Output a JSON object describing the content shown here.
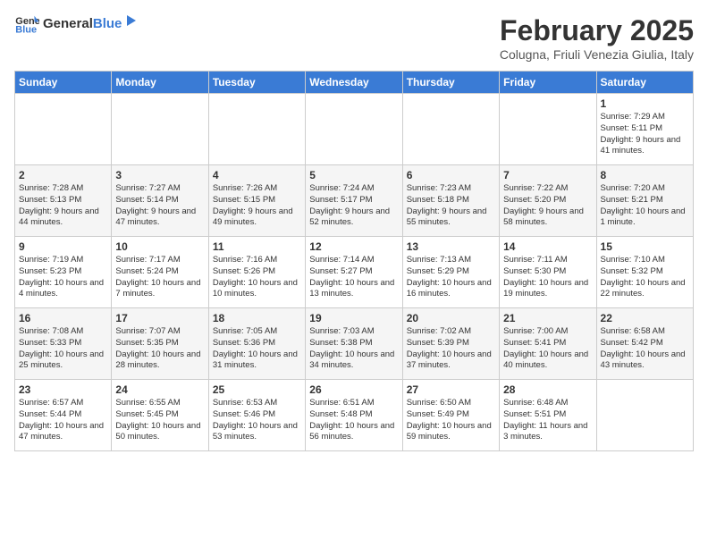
{
  "header": {
    "logo_general": "General",
    "logo_blue": "Blue",
    "month_year": "February 2025",
    "location": "Colugna, Friuli Venezia Giulia, Italy"
  },
  "weekdays": [
    "Sunday",
    "Monday",
    "Tuesday",
    "Wednesday",
    "Thursday",
    "Friday",
    "Saturday"
  ],
  "weeks": [
    [
      {
        "day": "",
        "info": ""
      },
      {
        "day": "",
        "info": ""
      },
      {
        "day": "",
        "info": ""
      },
      {
        "day": "",
        "info": ""
      },
      {
        "day": "",
        "info": ""
      },
      {
        "day": "",
        "info": ""
      },
      {
        "day": "1",
        "info": "Sunrise: 7:29 AM\nSunset: 5:11 PM\nDaylight: 9 hours and 41 minutes."
      }
    ],
    [
      {
        "day": "2",
        "info": "Sunrise: 7:28 AM\nSunset: 5:13 PM\nDaylight: 9 hours and 44 minutes."
      },
      {
        "day": "3",
        "info": "Sunrise: 7:27 AM\nSunset: 5:14 PM\nDaylight: 9 hours and 47 minutes."
      },
      {
        "day": "4",
        "info": "Sunrise: 7:26 AM\nSunset: 5:15 PM\nDaylight: 9 hours and 49 minutes."
      },
      {
        "day": "5",
        "info": "Sunrise: 7:24 AM\nSunset: 5:17 PM\nDaylight: 9 hours and 52 minutes."
      },
      {
        "day": "6",
        "info": "Sunrise: 7:23 AM\nSunset: 5:18 PM\nDaylight: 9 hours and 55 minutes."
      },
      {
        "day": "7",
        "info": "Sunrise: 7:22 AM\nSunset: 5:20 PM\nDaylight: 9 hours and 58 minutes."
      },
      {
        "day": "8",
        "info": "Sunrise: 7:20 AM\nSunset: 5:21 PM\nDaylight: 10 hours and 1 minute."
      }
    ],
    [
      {
        "day": "9",
        "info": "Sunrise: 7:19 AM\nSunset: 5:23 PM\nDaylight: 10 hours and 4 minutes."
      },
      {
        "day": "10",
        "info": "Sunrise: 7:17 AM\nSunset: 5:24 PM\nDaylight: 10 hours and 7 minutes."
      },
      {
        "day": "11",
        "info": "Sunrise: 7:16 AM\nSunset: 5:26 PM\nDaylight: 10 hours and 10 minutes."
      },
      {
        "day": "12",
        "info": "Sunrise: 7:14 AM\nSunset: 5:27 PM\nDaylight: 10 hours and 13 minutes."
      },
      {
        "day": "13",
        "info": "Sunrise: 7:13 AM\nSunset: 5:29 PM\nDaylight: 10 hours and 16 minutes."
      },
      {
        "day": "14",
        "info": "Sunrise: 7:11 AM\nSunset: 5:30 PM\nDaylight: 10 hours and 19 minutes."
      },
      {
        "day": "15",
        "info": "Sunrise: 7:10 AM\nSunset: 5:32 PM\nDaylight: 10 hours and 22 minutes."
      }
    ],
    [
      {
        "day": "16",
        "info": "Sunrise: 7:08 AM\nSunset: 5:33 PM\nDaylight: 10 hours and 25 minutes."
      },
      {
        "day": "17",
        "info": "Sunrise: 7:07 AM\nSunset: 5:35 PM\nDaylight: 10 hours and 28 minutes."
      },
      {
        "day": "18",
        "info": "Sunrise: 7:05 AM\nSunset: 5:36 PM\nDaylight: 10 hours and 31 minutes."
      },
      {
        "day": "19",
        "info": "Sunrise: 7:03 AM\nSunset: 5:38 PM\nDaylight: 10 hours and 34 minutes."
      },
      {
        "day": "20",
        "info": "Sunrise: 7:02 AM\nSunset: 5:39 PM\nDaylight: 10 hours and 37 minutes."
      },
      {
        "day": "21",
        "info": "Sunrise: 7:00 AM\nSunset: 5:41 PM\nDaylight: 10 hours and 40 minutes."
      },
      {
        "day": "22",
        "info": "Sunrise: 6:58 AM\nSunset: 5:42 PM\nDaylight: 10 hours and 43 minutes."
      }
    ],
    [
      {
        "day": "23",
        "info": "Sunrise: 6:57 AM\nSunset: 5:44 PM\nDaylight: 10 hours and 47 minutes."
      },
      {
        "day": "24",
        "info": "Sunrise: 6:55 AM\nSunset: 5:45 PM\nDaylight: 10 hours and 50 minutes."
      },
      {
        "day": "25",
        "info": "Sunrise: 6:53 AM\nSunset: 5:46 PM\nDaylight: 10 hours and 53 minutes."
      },
      {
        "day": "26",
        "info": "Sunrise: 6:51 AM\nSunset: 5:48 PM\nDaylight: 10 hours and 56 minutes."
      },
      {
        "day": "27",
        "info": "Sunrise: 6:50 AM\nSunset: 5:49 PM\nDaylight: 10 hours and 59 minutes."
      },
      {
        "day": "28",
        "info": "Sunrise: 6:48 AM\nSunset: 5:51 PM\nDaylight: 11 hours and 3 minutes."
      },
      {
        "day": "",
        "info": ""
      }
    ]
  ]
}
